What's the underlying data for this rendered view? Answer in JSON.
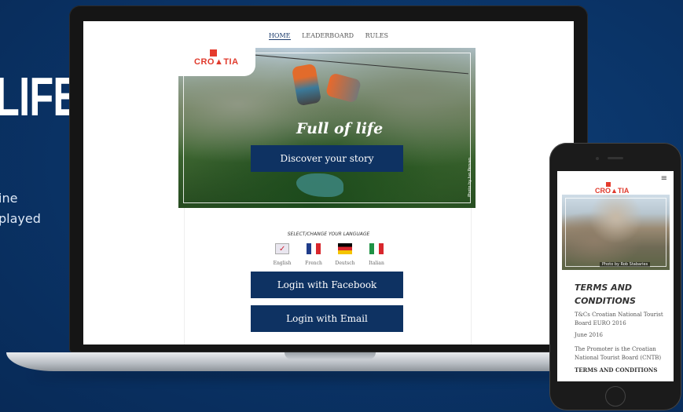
{
  "left_panel": {
    "headline": "LIFE",
    "caption_line1": "ine",
    "caption_line2": "played"
  },
  "site_nav": {
    "items": [
      {
        "label": "HOME",
        "active": true
      },
      {
        "label": "LEADERBOARD",
        "active": false
      },
      {
        "label": "RULES",
        "active": false
      }
    ]
  },
  "hero": {
    "logo_text": "CRO▲TIA",
    "title": "Full of life",
    "cta_label": "Discover your story",
    "photo_credit": "Photo by Ivo Pervan"
  },
  "language": {
    "title": "SELECT/CHANGE YOUR LANGUAGE",
    "options": [
      {
        "label": "English",
        "selected": true
      },
      {
        "label": "French",
        "selected": false
      },
      {
        "label": "Deutsch",
        "selected": false
      },
      {
        "label": "Italian",
        "selected": false
      }
    ]
  },
  "login": {
    "facebook_label": "Login with Facebook",
    "email_label": "Login with Email"
  },
  "phone": {
    "menu_icon": "hamburger-icon",
    "logo_text": "CRO▲TIA",
    "photo_credit": "Photo by Rob Stabaries",
    "terms_heading": "TERMS AND CONDITIONS",
    "line1": "T&Cs Croatian National Tourist Board EURO 2016",
    "line2": "June 2016",
    "line3": "The Promoter is the Croatian National Tourist Board (CNTB)",
    "line4": "TERMS AND CONDITIONS"
  },
  "colors": {
    "background": "#0a3366",
    "button": "#0e3262",
    "accent_red": "#e03a2c"
  }
}
